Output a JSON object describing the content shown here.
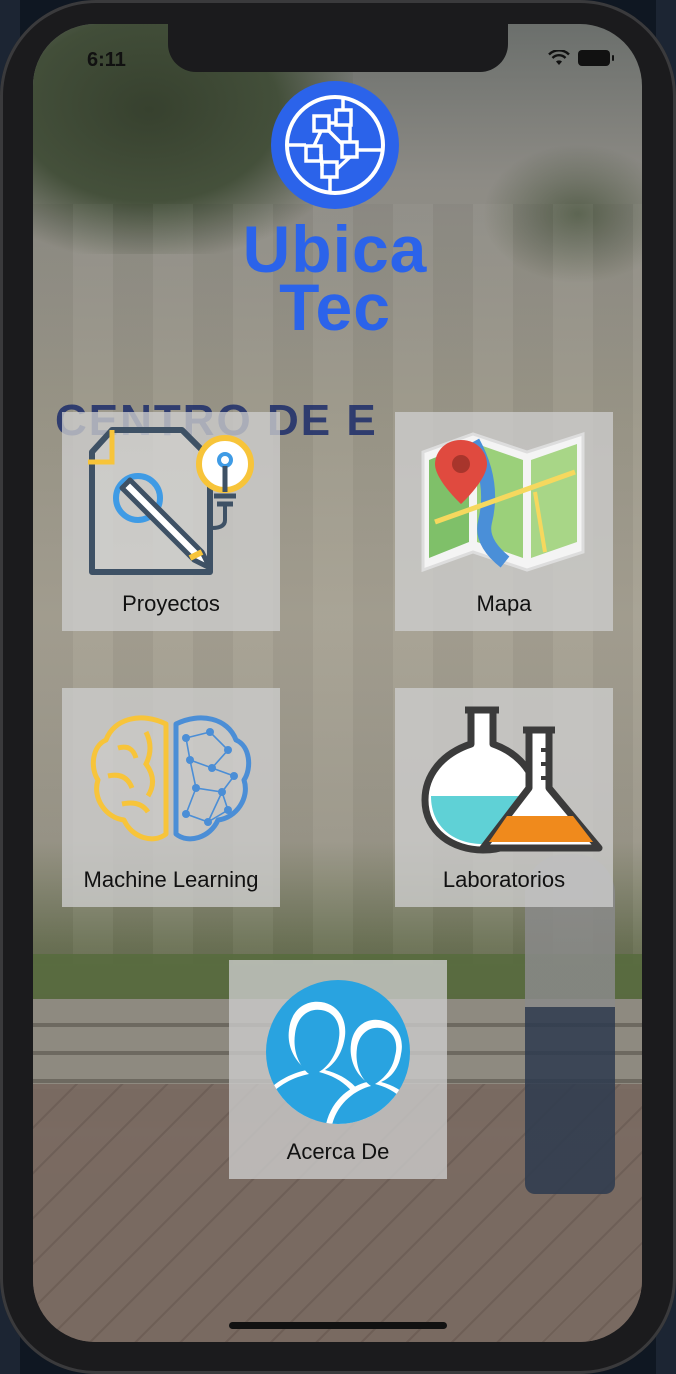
{
  "status_bar": {
    "time": "6:11",
    "icons": [
      "wifi-icon",
      "battery-icon"
    ]
  },
  "app": {
    "logo_icon": "network-globe-icon",
    "title_line1": "Ubica",
    "title_line2": "Tec",
    "brand_color": "#2b63ea"
  },
  "background": {
    "sign_text": "CENTRO DE E"
  },
  "menu": {
    "proyectos": {
      "label": "Proyectos",
      "icon": "document-pencil-lightbulb-icon"
    },
    "mapa": {
      "label": "Mapa",
      "icon": "map-pin-icon"
    },
    "machine_learning": {
      "label": "Machine Learning",
      "icon": "brain-network-icon"
    },
    "laboratorios": {
      "label": "Laboratorios",
      "icon": "lab-flasks-icon"
    },
    "acerca_de": {
      "label": "Acerca De",
      "icon": "two-people-icon"
    }
  }
}
